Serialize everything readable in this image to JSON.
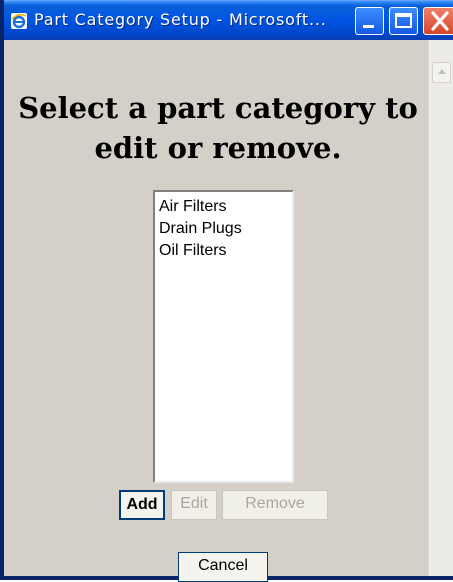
{
  "window": {
    "title": "Part Category Setup - Microsoft..."
  },
  "page": {
    "heading": "Select a part category to edit or remove."
  },
  "category_list": {
    "items": [
      "Air Filters",
      "Drain Plugs",
      "Oil Filters"
    ]
  },
  "buttons": {
    "add": "Add",
    "edit": "Edit",
    "remove": "Remove",
    "cancel": "Cancel"
  },
  "colors": {
    "titlebar": "#0054e3",
    "close_button": "#d4452a",
    "window_background": "#d4d0c8"
  }
}
